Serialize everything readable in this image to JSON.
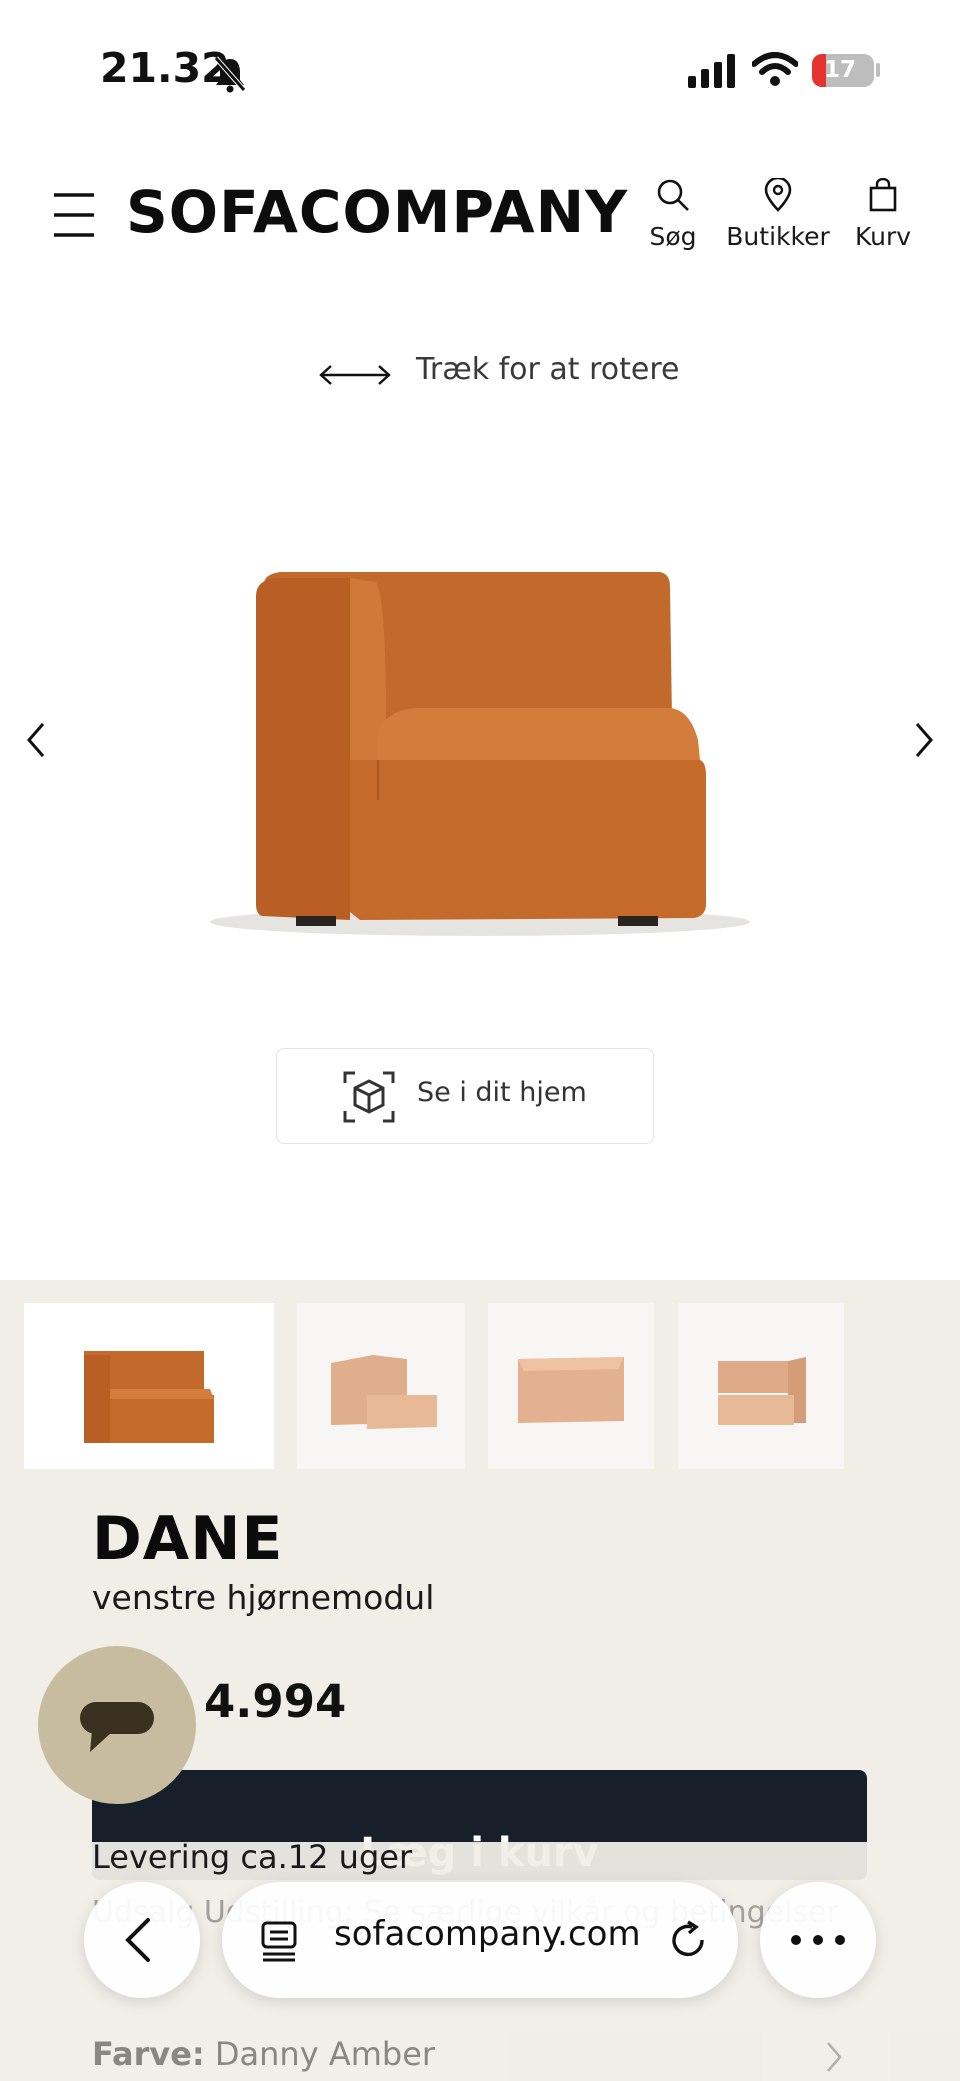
{
  "status_bar": {
    "time": "21.32",
    "battery": "17"
  },
  "header": {
    "logo": "SOFACOMPANY",
    "nav": [
      {
        "label": "Søg",
        "icon": "search-icon"
      },
      {
        "label": "Butikker",
        "icon": "location-pin-icon"
      },
      {
        "label": "Kurv",
        "icon": "shopping-bag-icon"
      }
    ]
  },
  "viewer": {
    "rotate_hint": "Træk for at rotere",
    "ar_button": "Se i dit hjem",
    "product_color": "#c66c2e"
  },
  "product": {
    "name": "DANE",
    "subtitle": "venstre hjørnemodul",
    "price": "4.994",
    "cart_button": "Læg i kurv",
    "delivery": "Levering ca.12 uger",
    "sale_note": "Udsalg Udstilling: Se særlige vilkår og betingelser",
    "color_label": "Farve:",
    "color_value": "Danny Amber"
  },
  "browser": {
    "url": "sofacompany.com"
  }
}
